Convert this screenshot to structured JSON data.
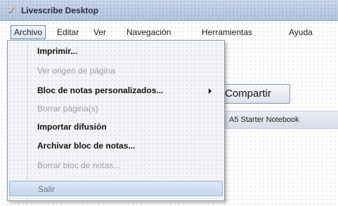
{
  "window": {
    "title": "Livescribe Desktop"
  },
  "menubar": {
    "items": [
      {
        "label": "Archivo"
      },
      {
        "label": "Editar"
      },
      {
        "label": "Ver"
      },
      {
        "label": "Navegación"
      },
      {
        "label": "Herramientas"
      },
      {
        "label": "Ayuda"
      }
    ]
  },
  "toolbar": {
    "share_label": "Compartir"
  },
  "notebook": {
    "name": "A5 Starter Notebook"
  },
  "file_menu": {
    "items": [
      {
        "label": "Imprimir...",
        "enabled": true
      },
      {
        "label": "Ver origen de página",
        "enabled": false
      },
      {
        "label": "Bloc de notas personalizados...",
        "enabled": true,
        "has_submenu": true
      },
      {
        "label": "Borrar página(s)",
        "enabled": false
      },
      {
        "label": "Importar difusión",
        "enabled": true
      },
      {
        "label": "Archivar bloc de notas...",
        "enabled": true
      },
      {
        "label": "Borrar bloc de notas...",
        "enabled": false
      },
      {
        "label": "Salir",
        "enabled": true,
        "highlighted": true
      }
    ]
  },
  "colors": {
    "menu_highlight": "#c4d6ef",
    "title_bar": "#b4c6df",
    "disabled_text": "#9a9ea6"
  }
}
